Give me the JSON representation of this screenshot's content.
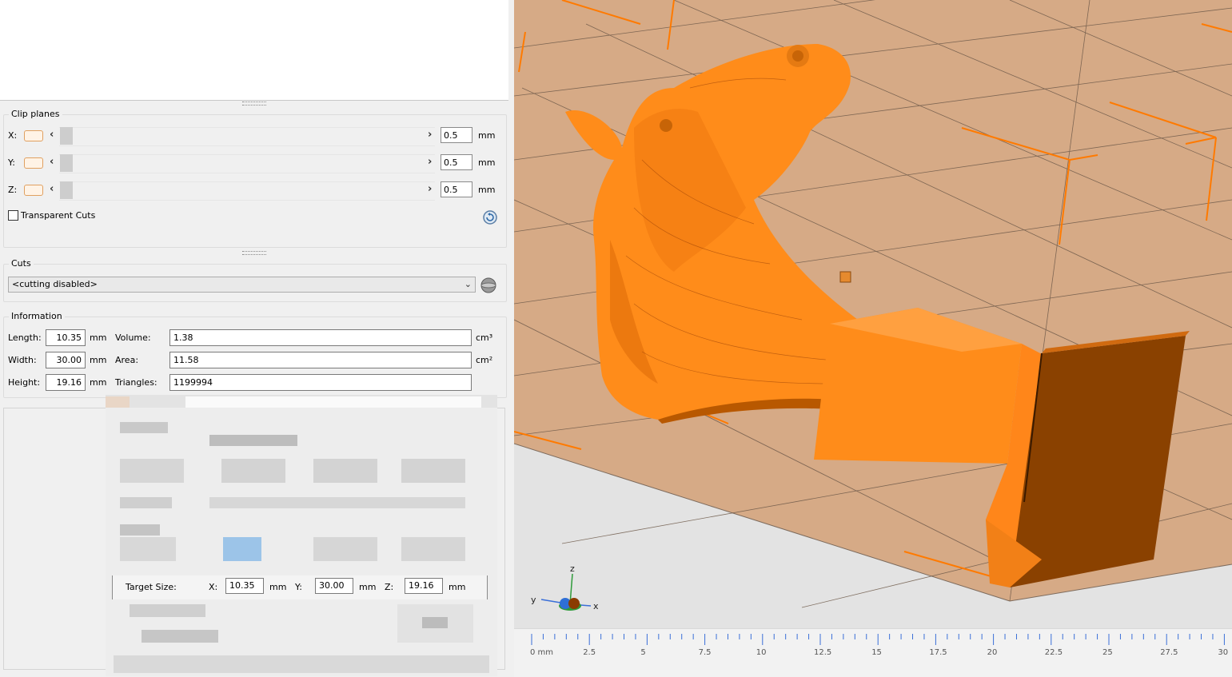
{
  "clip_planes": {
    "title": "Clip planes",
    "axes": [
      {
        "label": "X:",
        "value": "0.5",
        "unit": "mm"
      },
      {
        "label": "Y:",
        "value": "0.5",
        "unit": "mm"
      },
      {
        "label": "Z:",
        "value": "0.5",
        "unit": "mm"
      }
    ],
    "transparent_cuts_label": "Transparent Cuts"
  },
  "cuts": {
    "title": "Cuts",
    "selected": "<cutting disabled>"
  },
  "information": {
    "title": "Information",
    "length": {
      "label": "Length:",
      "value": "10.35",
      "unit": "mm"
    },
    "width": {
      "label": "Width:",
      "value": "30.00",
      "unit": "mm"
    },
    "height": {
      "label": "Height:",
      "value": "19.16",
      "unit": "mm"
    },
    "volume": {
      "label": "Volume:",
      "value": "1.38",
      "unit": "cm³"
    },
    "area": {
      "label": "Area:",
      "value": "11.58",
      "unit": "cm²"
    },
    "triangles": {
      "label": "Triangles:",
      "value": "1199994"
    }
  },
  "target_size": {
    "label": "Target Size:",
    "x": {
      "label": "X:",
      "value": "10.35",
      "unit": "mm"
    },
    "y": {
      "label": "Y:",
      "value": "30.00",
      "unit": "mm"
    },
    "z": {
      "label": "Z:",
      "value": "19.16",
      "unit": "mm"
    }
  },
  "viewport": {
    "axis_gizmo": {
      "z": "z",
      "y": "y",
      "x": "x"
    },
    "ruler_labels": [
      "0 mm",
      "2.5",
      "5",
      "7.5",
      "10",
      "12.5",
      "15",
      "17.5",
      "20",
      "22.5",
      "25",
      "27.5",
      "30"
    ],
    "colors": {
      "model": "#ff8c1a",
      "model_shadow": "#c85a00",
      "platform": "#d9ad8a",
      "bounding_box": "#ff7a00"
    }
  }
}
